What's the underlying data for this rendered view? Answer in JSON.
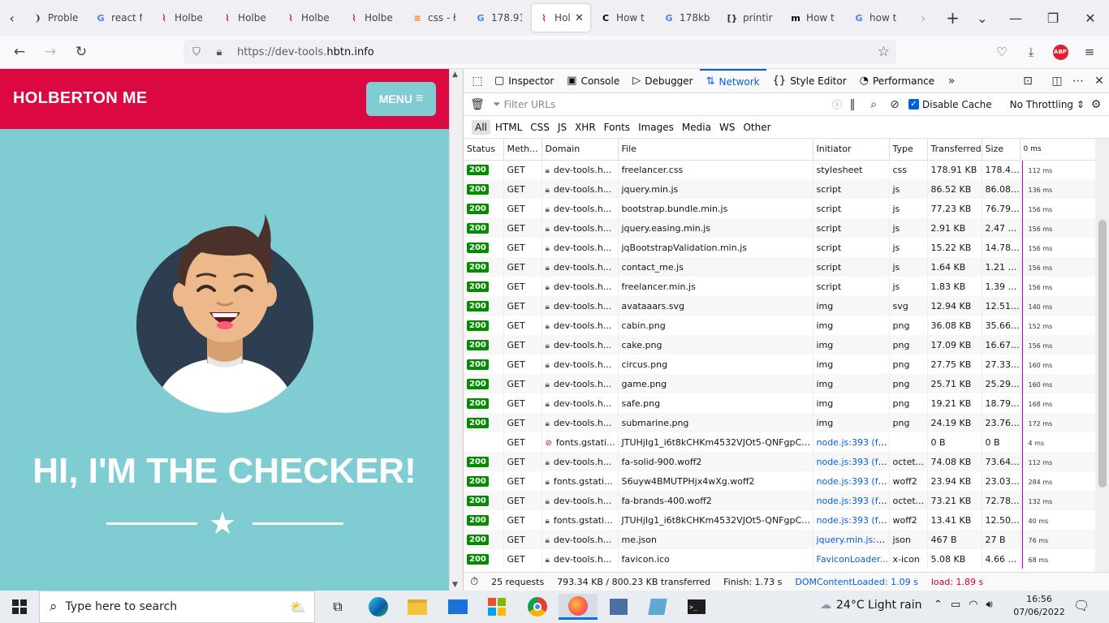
{
  "tabs": [
    {
      "label": "Proble",
      "icon": "page-icon"
    },
    {
      "label": "react f",
      "icon": "google-icon"
    },
    {
      "label": "Holbe",
      "icon": "holberton-icon"
    },
    {
      "label": "Holbe",
      "icon": "holberton-icon"
    },
    {
      "label": "Holbe",
      "icon": "holberton-icon"
    },
    {
      "label": "Holbe",
      "icon": "holberton-icon"
    },
    {
      "label": "css - ł",
      "icon": "stackoverflow-icon"
    },
    {
      "label": "178.91",
      "icon": "google-icon"
    },
    {
      "label": "Hol",
      "icon": "holberton-icon",
      "active": true
    },
    {
      "label": "How t",
      "icon": "c-icon"
    },
    {
      "label": "178kb",
      "icon": "google-icon"
    },
    {
      "label": "printir",
      "icon": "bracket-icon"
    },
    {
      "label": "How t",
      "icon": "m-icon"
    },
    {
      "label": "how t",
      "icon": "google-icon"
    }
  ],
  "url": {
    "prefix": "https://dev-tools.",
    "domain": "hbtn.info"
  },
  "site": {
    "brand": "HOLBERTON ME",
    "menu_label": "MENU",
    "hero_title": "HI, I'M THE CHECKER!"
  },
  "devtools": {
    "tabs": [
      "Inspector",
      "Console",
      "Debugger",
      "Network",
      "Style Editor",
      "Performance"
    ],
    "filter_placeholder": "Filter URLs",
    "disable_cache": "Disable Cache",
    "throttling": "No Throttling",
    "types": [
      "All",
      "HTML",
      "CSS",
      "JS",
      "XHR",
      "Fonts",
      "Images",
      "Media",
      "WS",
      "Other"
    ],
    "columns": [
      "Status",
      "Meth...",
      "Domain",
      "File",
      "Initiator",
      "Type",
      "Transferred",
      "Size",
      "0 ms"
    ],
    "rows": [
      {
        "status": "200",
        "method": "GET",
        "domain": "dev-tools.h...",
        "file": "freelancer.css",
        "initiator": "stylesheet",
        "type": "css",
        "transferred": "178.91 KB",
        "size": "178.4...",
        "time": "112 ms",
        "secure": true
      },
      {
        "status": "200",
        "method": "GET",
        "domain": "dev-tools.h...",
        "file": "jquery.min.js",
        "initiator": "script",
        "type": "js",
        "transferred": "86.52 KB",
        "size": "86.08...",
        "time": "136 ms",
        "secure": true
      },
      {
        "status": "200",
        "method": "GET",
        "domain": "dev-tools.h...",
        "file": "bootstrap.bundle.min.js",
        "initiator": "script",
        "type": "js",
        "transferred": "77.23 KB",
        "size": "76.79...",
        "time": "156 ms",
        "secure": true
      },
      {
        "status": "200",
        "method": "GET",
        "domain": "dev-tools.h...",
        "file": "jquery.easing.min.js",
        "initiator": "script",
        "type": "js",
        "transferred": "2.91 KB",
        "size": "2.47 KB",
        "time": "156 ms",
        "secure": true
      },
      {
        "status": "200",
        "method": "GET",
        "domain": "dev-tools.h...",
        "file": "jqBootstrapValidation.min.js",
        "initiator": "script",
        "type": "js",
        "transferred": "15.22 KB",
        "size": "14.78...",
        "time": "156 ms",
        "secure": true
      },
      {
        "status": "200",
        "method": "GET",
        "domain": "dev-tools.h...",
        "file": "contact_me.js",
        "initiator": "script",
        "type": "js",
        "transferred": "1.64 KB",
        "size": "1.21 KB",
        "time": "156 ms",
        "secure": true
      },
      {
        "status": "200",
        "method": "GET",
        "domain": "dev-tools.h...",
        "file": "freelancer.min.js",
        "initiator": "script",
        "type": "js",
        "transferred": "1.83 KB",
        "size": "1.39 KB",
        "time": "156 ms",
        "secure": true
      },
      {
        "status": "200",
        "method": "GET",
        "domain": "dev-tools.h...",
        "file": "avataaars.svg",
        "initiator": "img",
        "type": "svg",
        "transferred": "12.94 KB",
        "size": "12.51...",
        "time": "140 ms",
        "secure": true
      },
      {
        "status": "200",
        "method": "GET",
        "domain": "dev-tools.h...",
        "file": "cabin.png",
        "initiator": "img",
        "type": "png",
        "transferred": "36.08 KB",
        "size": "35.66...",
        "time": "152 ms",
        "secure": true
      },
      {
        "status": "200",
        "method": "GET",
        "domain": "dev-tools.h...",
        "file": "cake.png",
        "initiator": "img",
        "type": "png",
        "transferred": "17.09 KB",
        "size": "16.67...",
        "time": "156 ms",
        "secure": true
      },
      {
        "status": "200",
        "method": "GET",
        "domain": "dev-tools.h...",
        "file": "circus.png",
        "initiator": "img",
        "type": "png",
        "transferred": "27.75 KB",
        "size": "27.33...",
        "time": "160 ms",
        "secure": true
      },
      {
        "status": "200",
        "method": "GET",
        "domain": "dev-tools.h...",
        "file": "game.png",
        "initiator": "img",
        "type": "png",
        "transferred": "25.71 KB",
        "size": "25.29...",
        "time": "160 ms",
        "secure": true
      },
      {
        "status": "200",
        "method": "GET",
        "domain": "dev-tools.h...",
        "file": "safe.png",
        "initiator": "img",
        "type": "png",
        "transferred": "19.21 KB",
        "size": "18.79...",
        "time": "168 ms",
        "secure": true
      },
      {
        "status": "200",
        "method": "GET",
        "domain": "dev-tools.h...",
        "file": "submarine.png",
        "initiator": "img",
        "type": "png",
        "transferred": "24.19 KB",
        "size": "23.76...",
        "time": "172 ms",
        "secure": true
      },
      {
        "status": "",
        "method": "GET",
        "domain": "fonts.gstati...",
        "file": "JTUHjIg1_i6t8kCHKm4532VJOt5-QNFgpCuM73",
        "initiator": "node.js:393 (fo...",
        "type": "",
        "transferred": "0 B",
        "size": "0 B",
        "time": "4 ms",
        "secure": false,
        "link": true
      },
      {
        "status": "200",
        "method": "GET",
        "domain": "dev-tools.h...",
        "file": "fa-solid-900.woff2",
        "initiator": "node.js:393 (fo...",
        "type": "octet...",
        "transferred": "74.08 KB",
        "size": "73.64...",
        "time": "112 ms",
        "secure": true,
        "link": true
      },
      {
        "status": "200",
        "method": "GET",
        "domain": "fonts.gstati...",
        "file": "S6uyw4BMUTPHjx4wXg.woff2",
        "initiator": "node.js:393 (fo...",
        "type": "woff2",
        "transferred": "23.94 KB",
        "size": "23.03...",
        "time": "284 ms",
        "secure": true,
        "link": true
      },
      {
        "status": "200",
        "method": "GET",
        "domain": "dev-tools.h...",
        "file": "fa-brands-400.woff2",
        "initiator": "node.js:393 (fo...",
        "type": "octet...",
        "transferred": "73.21 KB",
        "size": "72.78...",
        "time": "132 ms",
        "secure": true,
        "link": true
      },
      {
        "status": "200",
        "method": "GET",
        "domain": "fonts.gstati...",
        "file": "JTUHjIg1_i6t8kCHKm4532VJOt5-QNFgpCuM73",
        "initiator": "node.js:393 (fo...",
        "type": "woff2",
        "transferred": "13.41 KB",
        "size": "12.50...",
        "time": "40 ms",
        "secure": true,
        "link": true
      },
      {
        "status": "200",
        "method": "GET",
        "domain": "dev-tools.h...",
        "file": "me.json",
        "initiator": "jquery.min.js:2...",
        "type": "json",
        "transferred": "467 B",
        "size": "27 B",
        "time": "76 ms",
        "secure": true,
        "link": true
      },
      {
        "status": "200",
        "method": "GET",
        "domain": "dev-tools.h...",
        "file": "favicon.ico",
        "initiator": "FaviconLoader...",
        "type": "x-icon",
        "transferred": "5.08 KB",
        "size": "4.66 KB",
        "time": "68 ms",
        "secure": true,
        "link": true
      }
    ],
    "status_bar": {
      "requests": "25 requests",
      "transferred": "793.34 KB / 800.23 KB transferred",
      "finish": "Finish: 1.73 s",
      "dom": "DOMContentLoaded: 1.09 s",
      "load": "load: 1.89 s"
    },
    "colors": {
      "status_ok": "#058b00",
      "dom": "#0060df",
      "load": "#d70022",
      "active_tab": "#0061e0"
    }
  },
  "taskbar": {
    "search_placeholder": "Type here to search",
    "weather": "24°C  Light rain",
    "time": "16:56",
    "date": "07/06/2022"
  }
}
